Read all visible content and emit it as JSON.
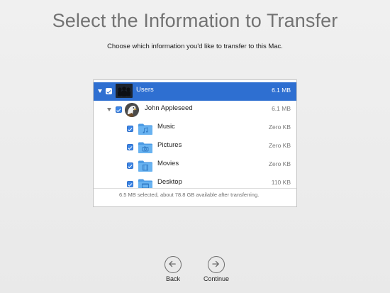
{
  "header": {
    "title": "Select the Information to Transfer",
    "subtitle": "Choose which information you'd like to transfer to this Mac."
  },
  "tree": {
    "rows": [
      {
        "label": "Users",
        "size": "6.1 MB",
        "selected": true,
        "level": 0,
        "icon": "users-icon"
      },
      {
        "label": "John Appleseed",
        "size": "6.1 MB",
        "selected": false,
        "level": 1,
        "icon": "eagle-avatar-icon"
      },
      {
        "label": "Music",
        "size": "Zero KB",
        "selected": false,
        "level": 2,
        "icon": "music-folder-icon"
      },
      {
        "label": "Pictures",
        "size": "Zero KB",
        "selected": false,
        "level": 2,
        "icon": "pictures-folder-icon"
      },
      {
        "label": "Movies",
        "size": "Zero KB",
        "selected": false,
        "level": 2,
        "icon": "movies-folder-icon"
      },
      {
        "label": "Desktop",
        "size": "110 KB",
        "selected": false,
        "level": 2,
        "icon": "desktop-folder-icon"
      }
    ]
  },
  "status": {
    "text": "6.5 MB selected, about 78.8 GB available after transferring."
  },
  "nav": {
    "back_label": "Back",
    "continue_label": "Continue"
  },
  "colors": {
    "selection": "#2e6fd1",
    "checkbox": "#3d86e6",
    "folder": "#5aa7ea",
    "title": "#737373"
  }
}
